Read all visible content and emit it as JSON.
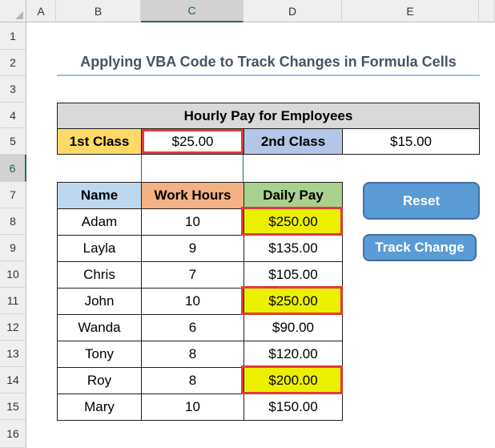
{
  "columns": [
    "A",
    "B",
    "C",
    "D",
    "E"
  ],
  "rows": [
    "1",
    "2",
    "3",
    "4",
    "5",
    "6",
    "7",
    "8",
    "9",
    "10",
    "11",
    "12",
    "13",
    "14",
    "15",
    "16"
  ],
  "title": "Applying VBA Code to Track Changes in Formula Cells",
  "pay_table": {
    "header": "Hourly Pay for Employees",
    "first_class_label": "1st Class",
    "first_class_value": "$25.00",
    "second_class_label": "2nd Class",
    "second_class_value": "$15.00"
  },
  "emp_table": {
    "headers": [
      "Name",
      "Work Hours",
      "Daily Pay"
    ],
    "rows": [
      {
        "name": "Adam",
        "hours": "10",
        "pay": "$250.00"
      },
      {
        "name": "Layla",
        "hours": "9",
        "pay": "$135.00"
      },
      {
        "name": "Chris",
        "hours": "7",
        "pay": "$105.00"
      },
      {
        "name": "John",
        "hours": "10",
        "pay": "$250.00"
      },
      {
        "name": "Wanda",
        "hours": "6",
        "pay": "$90.00"
      },
      {
        "name": "Tony",
        "hours": "8",
        "pay": "$120.00"
      },
      {
        "name": "Roy",
        "hours": "8",
        "pay": "$200.00"
      },
      {
        "name": "Mary",
        "hours": "10",
        "pay": "$150.00"
      }
    ]
  },
  "buttons": {
    "reset": "Reset",
    "track_change": "Track Change"
  },
  "colors": {
    "header_gray": "#d9d9d9",
    "class_yellow": "#ffd966",
    "class_lilac": "#b4c6e7",
    "name_blue": "#bdd7ee",
    "hours_orange": "#f4b183",
    "pay_green": "#a9d18e",
    "changed_highlight": "#ecf000",
    "change_border": "#e03a3a",
    "button_blue": "#5b9bd5"
  }
}
